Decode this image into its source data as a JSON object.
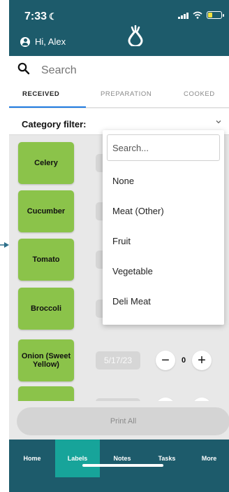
{
  "status": {
    "time": "7:33"
  },
  "header": {
    "greeting": "Hi, Alex"
  },
  "search": {
    "placeholder": "Search"
  },
  "tabs": [
    "RECEIVED",
    "PREPARATION",
    "COOKED"
  ],
  "filter": {
    "label": "Category filter:"
  },
  "items": [
    {
      "name": "Celery",
      "date": "",
      "qty": ""
    },
    {
      "name": "Cucumber",
      "date": "",
      "qty": ""
    },
    {
      "name": "Tomato",
      "date": "",
      "qty": ""
    },
    {
      "name": "Broccoli",
      "date": "",
      "qty": ""
    },
    {
      "name": "Onion (Sweet Yellow)",
      "date": "5/17/23",
      "qty": "0"
    },
    {
      "name": "",
      "date": "",
      "qty": ""
    }
  ],
  "dropdown": {
    "placeholder": "Search...",
    "options": [
      "None",
      "Meat (Other)",
      "Fruit",
      "Vegetable",
      "Deli Meat"
    ]
  },
  "actions": {
    "print_all": "Print All"
  },
  "nav": [
    "Home",
    "Labels",
    "Notes",
    "Tasks",
    "More"
  ],
  "colors": {
    "header": "#1d5b6b",
    "active_tab": "#17a49a",
    "item_card": "#8bc34a",
    "accent": "#1f7ae0"
  }
}
